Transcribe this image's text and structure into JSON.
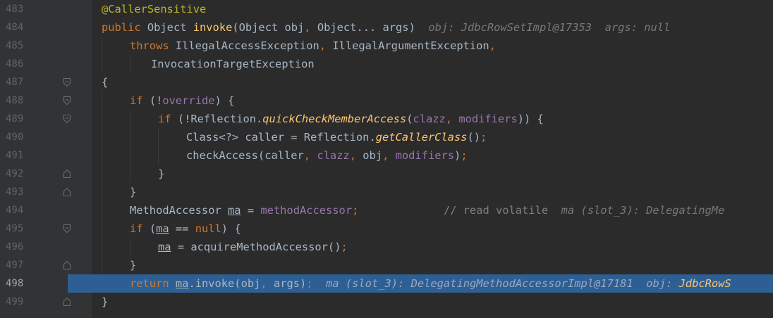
{
  "line_numbers": [
    "483",
    "484",
    "485",
    "486",
    "487",
    "488",
    "489",
    "490",
    "491",
    "492",
    "493",
    "494",
    "495",
    "496",
    "497",
    "498",
    "499"
  ],
  "current_line": "498",
  "code": {
    "l483": {
      "annotation": "@CallerSensitive"
    },
    "l484": {
      "kw_public": "public",
      "t1": " Object ",
      "method": "invoke",
      "t2": "(Object obj",
      "comma1": ",",
      "t3": " Object... args)",
      "hint1_label": "obj:",
      "hint1_value": "JdbcRowSetImpl@17353",
      "hint2_label": "args:",
      "hint2_value": "null"
    },
    "l485": {
      "kw_throws": "throws",
      "t1": " IllegalAccessException",
      "comma1": ",",
      "t2": " IllegalArgumentException",
      "comma2": ","
    },
    "l486": {
      "t1": "InvocationTargetException"
    },
    "l487": {
      "t1": "{"
    },
    "l488": {
      "kw_if": "if",
      "t1": " (!",
      "field": "override",
      "t2": ") {"
    },
    "l489": {
      "kw_if": "if",
      "t1": " (!Reflection.",
      "method": "quickCheckMemberAccess",
      "t2": "(",
      "field1": "clazz",
      "comma1": ",",
      "field2": "modifiers",
      "t3": ")) {"
    },
    "l490": {
      "t1": "Class<?> caller = Reflection.",
      "method": "getCallerClass",
      "t2": "()",
      "semi": ";"
    },
    "l491": {
      "t1": "checkAccess(caller",
      "comma1": ",",
      "field1": "clazz",
      "comma2": ",",
      "t2": " obj",
      "comma3": ",",
      "field2": "modifiers",
      "t3": ")",
      "semi": ";"
    },
    "l492": {
      "t1": "}"
    },
    "l493": {
      "t1": "}"
    },
    "l494": {
      "t1": "MethodAccessor ",
      "var": "ma",
      "t2": " = ",
      "field": "methodAccessor",
      "semi": ";",
      "comment": "// read volatile",
      "hint_label": "ma (slot_3):",
      "hint_value": "DelegatingMe"
    },
    "l495": {
      "kw_if": "if",
      "t1": " (",
      "var": "ma",
      "t2": " == ",
      "kw_null": "null",
      "t3": ") {"
    },
    "l496": {
      "var": "ma",
      "t1": " = acquireMethodAccessor()",
      "semi": ";"
    },
    "l497": {
      "t1": "}"
    },
    "l498": {
      "kw_return": "return",
      "var": "ma",
      "t1": ".invoke(obj",
      "comma1": ",",
      "t2": " args)",
      "semi": ";",
      "hint1_label": "ma (slot_3):",
      "hint1_value": "DelegatingMethodAccessorImpl@17181",
      "hint2_label": "obj:",
      "hint2_value": "JdbcRowS"
    },
    "l499": {
      "t1": "}"
    }
  },
  "colors": {
    "background": "#2b2b2b",
    "gutter": "#313335",
    "current_line": "#2d5f94",
    "keyword": "#cc7832",
    "annotation": "#bbb529",
    "method": "#ffc66d",
    "field": "#9876aa",
    "text": "#a9b7c6",
    "comment": "#808080"
  },
  "icons": {
    "fold_open": "fold-start-icon",
    "fold_close": "fold-end-icon"
  }
}
